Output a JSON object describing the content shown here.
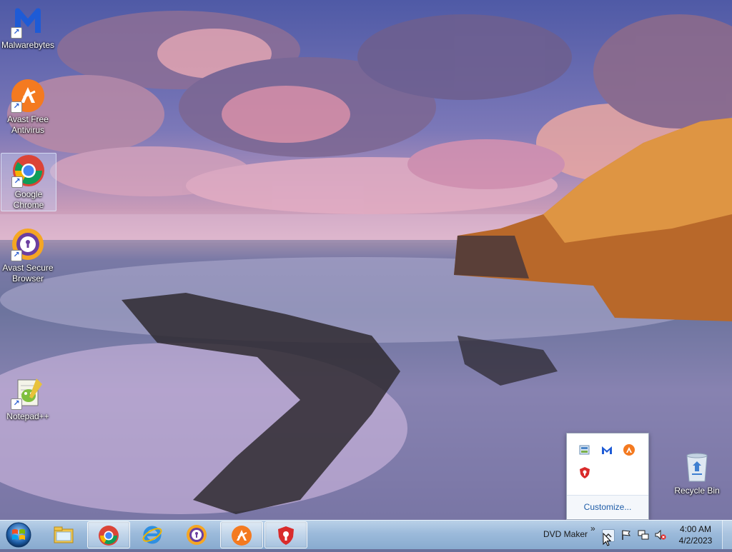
{
  "desktop": {
    "icons": [
      {
        "label": "Malwarebytes"
      },
      {
        "label": "Avast Free Antivirus"
      },
      {
        "label": "Google Chrome"
      },
      {
        "label": "Avast Secure Browser"
      },
      {
        "label": "Notepad++"
      },
      {
        "label": "Recycle Bin"
      }
    ]
  },
  "tray_popup": {
    "customize_label": "Customize..."
  },
  "taskbar": {
    "start_icon": "windows-start-orb",
    "pinned": [
      {
        "icon": "explorer-icon"
      },
      {
        "icon": "chrome-icon"
      },
      {
        "icon": "internet-explorer-icon"
      },
      {
        "icon": "avast-secure-browser-icon"
      },
      {
        "icon": "avast-antivirus-icon"
      },
      {
        "icon": "avast-shield-icon"
      }
    ],
    "tray_toolbar_label": "DVD Maker",
    "overflow_chevron": "»",
    "clock": {
      "time": "4:00 AM",
      "date": "4/2/2023"
    }
  },
  "colors": {
    "avast_orange": "#f47a20",
    "chrome_red": "#db4437",
    "malwarebytes_blue": "#1e5bd6",
    "taskbar": "#a6c2de"
  }
}
